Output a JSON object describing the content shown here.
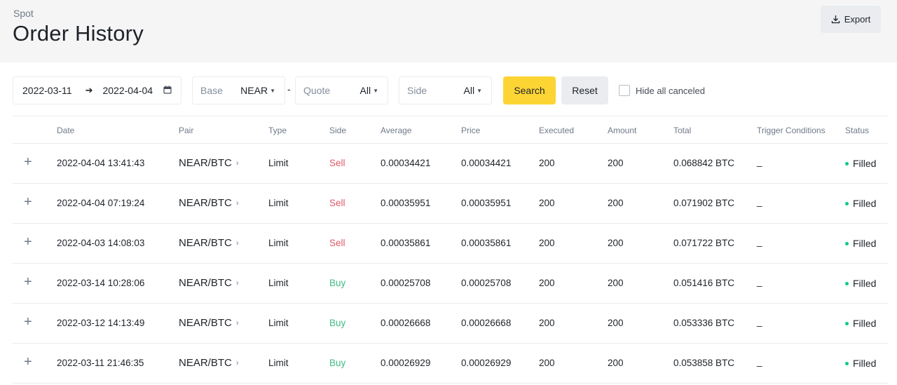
{
  "header": {
    "breadcrumb": "Spot",
    "title": "Order History",
    "export_label": "Export"
  },
  "filters": {
    "date_from": "2022-03-11",
    "date_to": "2022-04-04",
    "base_label": "Base",
    "base_value": "NEAR",
    "separator": "-",
    "quote_label": "Quote",
    "quote_value": "All",
    "side_label": "Side",
    "side_value": "All",
    "search_label": "Search",
    "reset_label": "Reset",
    "hide_canceled_label": "Hide all canceled",
    "hide_canceled_checked": false
  },
  "table": {
    "columns": [
      "Date",
      "Pair",
      "Type",
      "Side",
      "Average",
      "Price",
      "Executed",
      "Amount",
      "Total",
      "Trigger Conditions",
      "Status"
    ],
    "rows": [
      {
        "date": "2022-04-04 13:41:43",
        "pair": "NEAR/BTC",
        "type": "Limit",
        "side": "Sell",
        "average": "0.00034421",
        "price": "0.00034421",
        "executed": "200",
        "amount": "200",
        "total": "0.068842 BTC",
        "trigger": "_",
        "status": "Filled"
      },
      {
        "date": "2022-04-04 07:19:24",
        "pair": "NEAR/BTC",
        "type": "Limit",
        "side": "Sell",
        "average": "0.00035951",
        "price": "0.00035951",
        "executed": "200",
        "amount": "200",
        "total": "0.071902 BTC",
        "trigger": "_",
        "status": "Filled"
      },
      {
        "date": "2022-04-03 14:08:03",
        "pair": "NEAR/BTC",
        "type": "Limit",
        "side": "Sell",
        "average": "0.00035861",
        "price": "0.00035861",
        "executed": "200",
        "amount": "200",
        "total": "0.071722 BTC",
        "trigger": "_",
        "status": "Filled"
      },
      {
        "date": "2022-03-14 10:28:06",
        "pair": "NEAR/BTC",
        "type": "Limit",
        "side": "Buy",
        "average": "0.00025708",
        "price": "0.00025708",
        "executed": "200",
        "amount": "200",
        "total": "0.051416 BTC",
        "trigger": "_",
        "status": "Filled"
      },
      {
        "date": "2022-03-12 14:13:49",
        "pair": "NEAR/BTC",
        "type": "Limit",
        "side": "Buy",
        "average": "0.00026668",
        "price": "0.00026668",
        "executed": "200",
        "amount": "200",
        "total": "0.053336 BTC",
        "trigger": "_",
        "status": "Filled"
      },
      {
        "date": "2022-03-11 21:46:35",
        "pair": "NEAR/BTC",
        "type": "Limit",
        "side": "Buy",
        "average": "0.00026929",
        "price": "0.00026929",
        "executed": "200",
        "amount": "200",
        "total": "0.053858 BTC",
        "trigger": "_",
        "status": "Filled"
      }
    ]
  },
  "colors": {
    "accent_yellow": "#fcd535",
    "sell_red": "#e05a6a",
    "buy_green": "#3ebd84",
    "filled_dot": "#0ecb81"
  },
  "icons": {
    "export": "download-icon",
    "calendar": "calendar-icon",
    "expand": "plus-icon",
    "pair_link": "chevron-right-icon",
    "dropdown": "caret-down-icon"
  }
}
